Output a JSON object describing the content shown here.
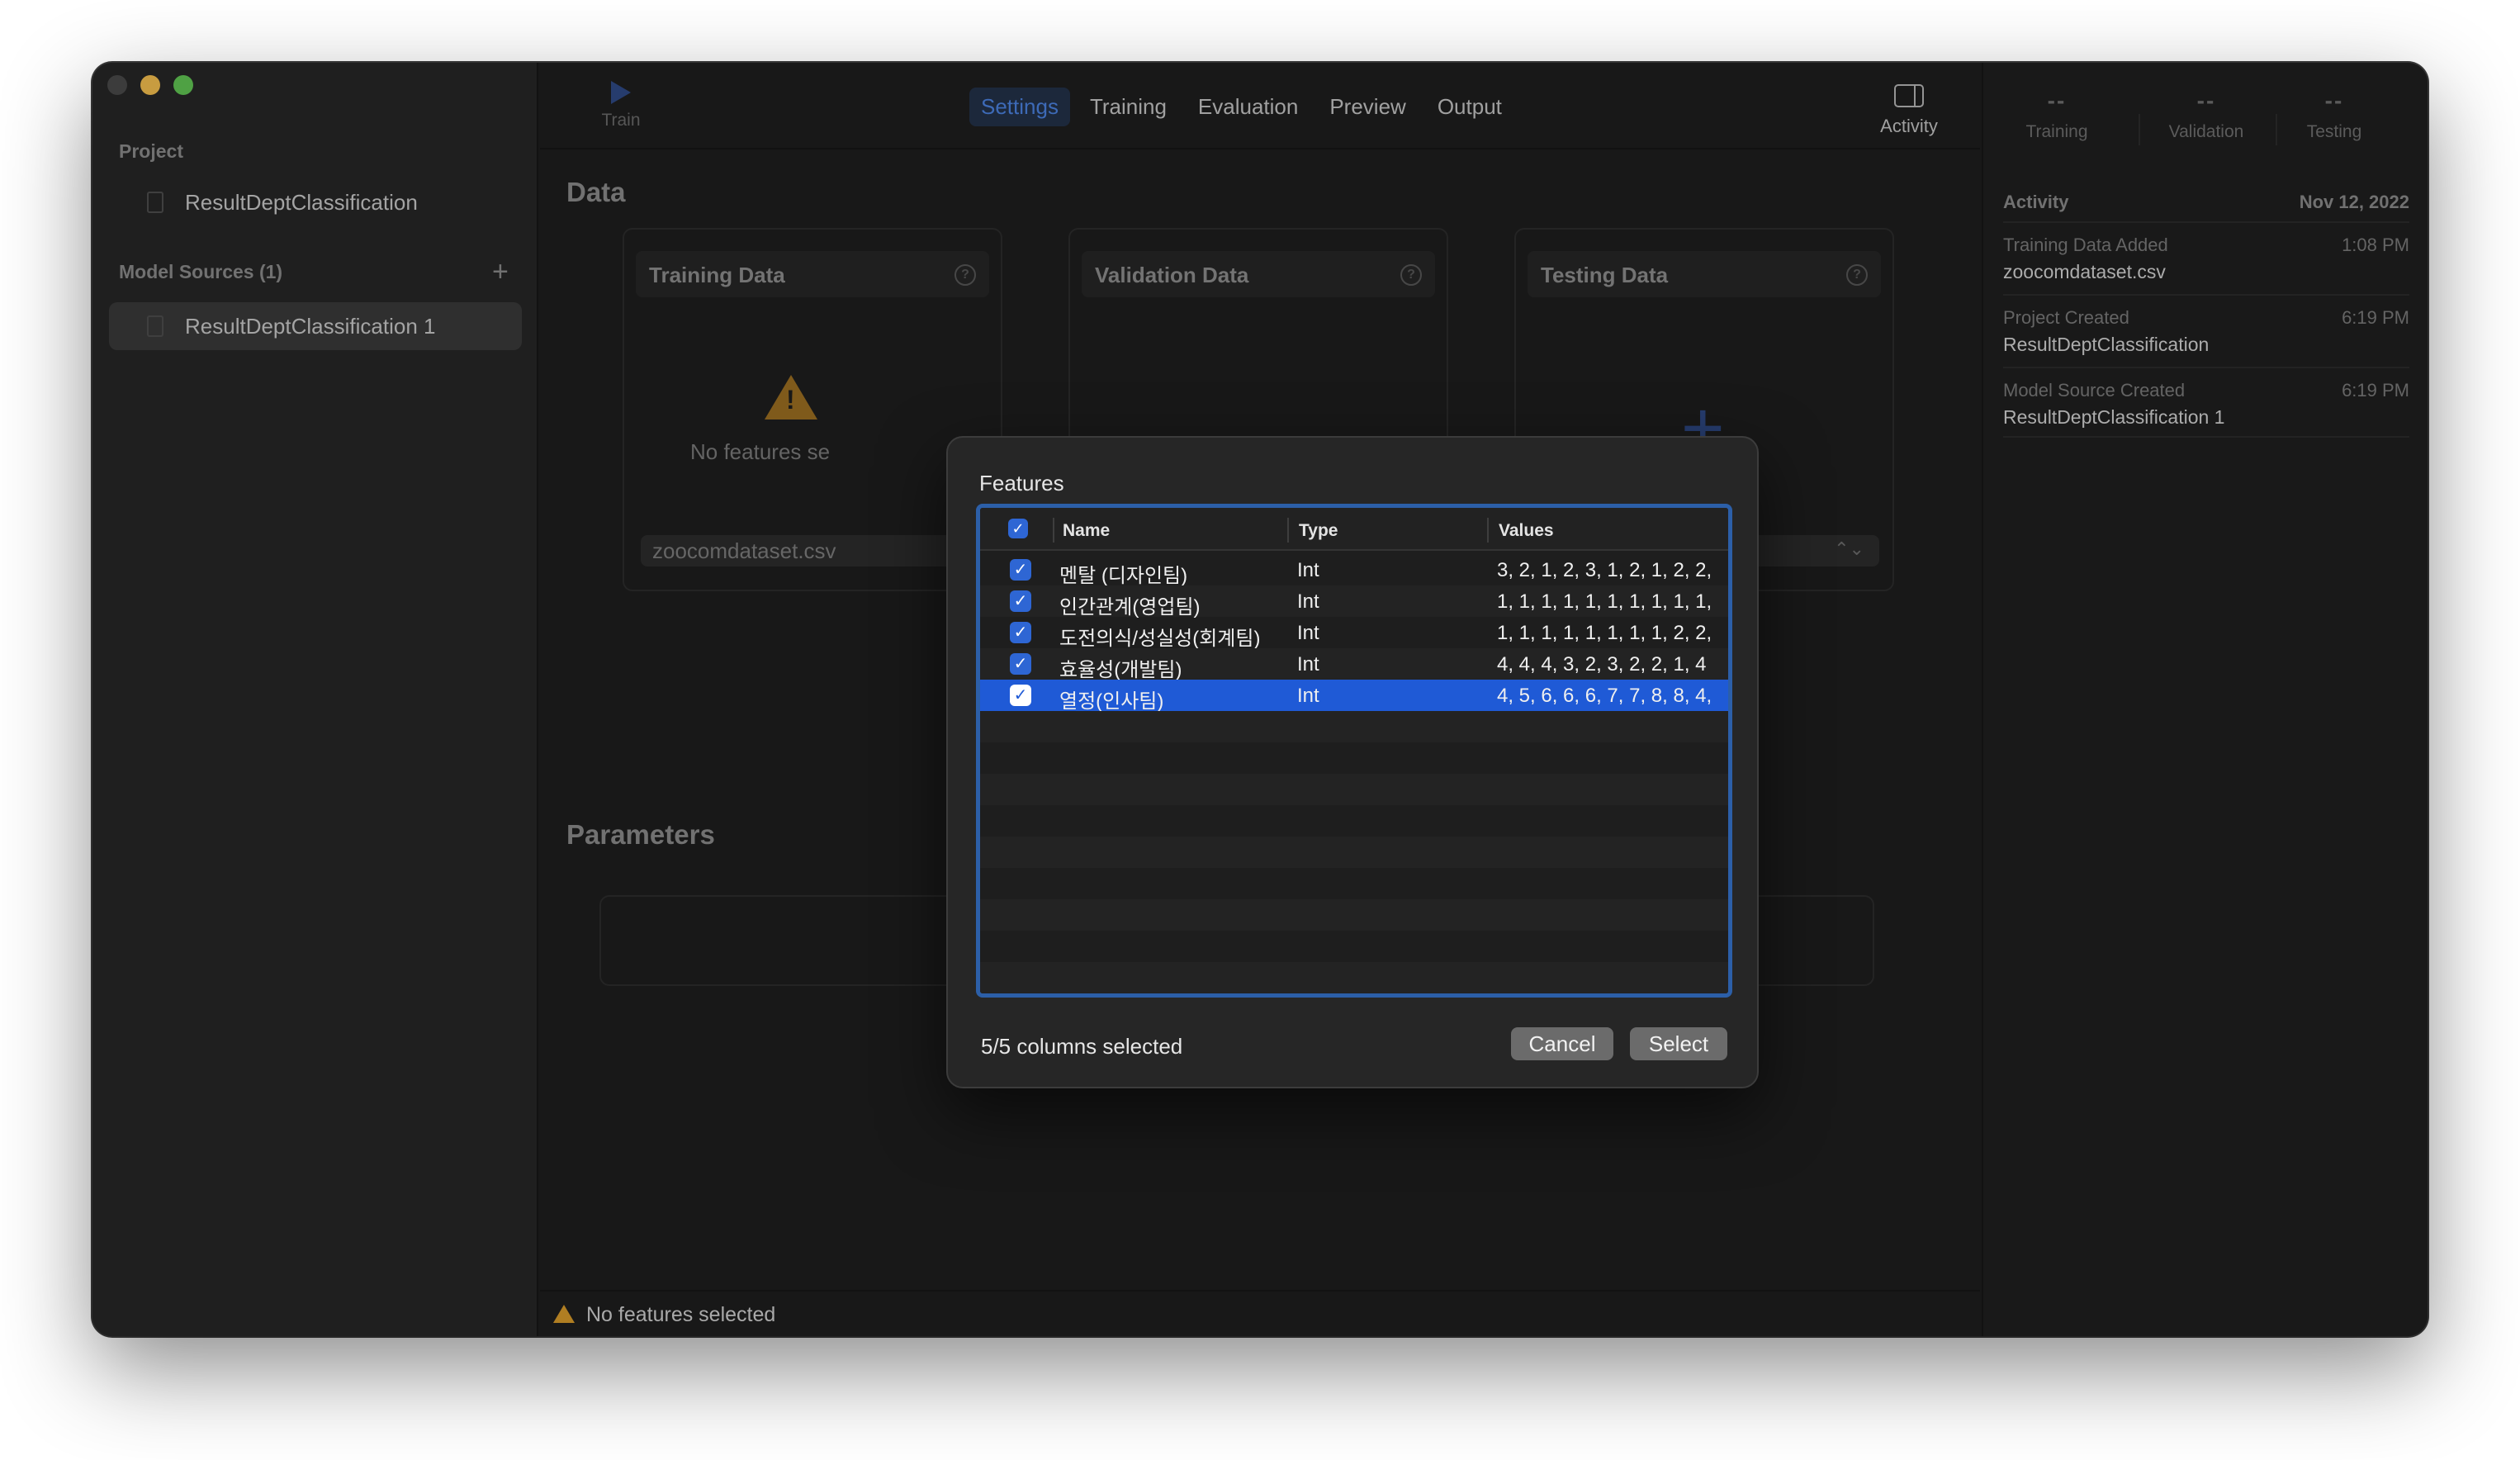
{
  "sidebar": {
    "project_label": "Project",
    "project_name": "ResultDeptClassification",
    "model_sources_label": "Model Sources (1)",
    "model_source_item": "ResultDeptClassification 1"
  },
  "toolbar": {
    "train_label": "Train",
    "tabs": [
      "Settings",
      "Training",
      "Evaluation",
      "Preview",
      "Output"
    ],
    "active_tab": "Settings",
    "activity_label": "Activity"
  },
  "main": {
    "data_heading": "Data",
    "parameters_heading": "Parameters",
    "cards": {
      "training": {
        "title": "Training Data",
        "message": "No features se",
        "file": "zoocomdataset.csv"
      },
      "validation": {
        "title": "Validation Data"
      },
      "testing": {
        "title": "Testing Data"
      }
    },
    "status_text": "No features selected"
  },
  "right_panel": {
    "stats": [
      {
        "value": "--",
        "label": "Training"
      },
      {
        "value": "--",
        "label": "Validation"
      },
      {
        "value": "--",
        "label": "Testing"
      }
    ],
    "activity_label": "Activity",
    "activity_date": "Nov 12, 2022",
    "entries": [
      {
        "title": "Training Data Added",
        "time": "1:08 PM",
        "value": "zoocomdataset.csv"
      },
      {
        "title": "Project Created",
        "time": "6:19 PM",
        "value": "ResultDeptClassification"
      },
      {
        "title": "Model Source Created",
        "time": "6:19 PM",
        "value": "ResultDeptClassification 1"
      }
    ]
  },
  "dialog": {
    "title": "Features",
    "columns": {
      "name": "Name",
      "type": "Type",
      "values": "Values"
    },
    "rows": [
      {
        "name": "멘탈 (디자인팀)",
        "type": "Int",
        "values": "3, 2, 1, 2, 3, 1, 2, 1, 2, 2,",
        "checked": true
      },
      {
        "name": "인간관계(영업팀)",
        "type": "Int",
        "values": "1, 1, 1, 1, 1, 1, 1, 1, 1, 1,",
        "checked": true
      },
      {
        "name": "도전의식/성실성(회계팀)",
        "type": "Int",
        "values": "1, 1, 1, 1, 1, 1, 1, 1, 2, 2,",
        "checked": true
      },
      {
        "name": "효율성(개발팀)",
        "type": "Int",
        "values": "4, 4, 4, 3, 2, 3, 2, 2, 1, 4",
        "checked": true
      },
      {
        "name": "열정(인사팀)",
        "type": "Int",
        "values": "4, 5, 6, 6, 6, 7, 7, 8, 8, 4,",
        "checked": true,
        "selected": true
      }
    ],
    "status": "5/5 columns selected",
    "cancel_label": "Cancel",
    "select_label": "Select",
    "check_glyph": "✓"
  },
  "colors": {
    "accent": "#2e66d4",
    "selection": "#1f5ad6",
    "warning": "#d79a2a"
  }
}
